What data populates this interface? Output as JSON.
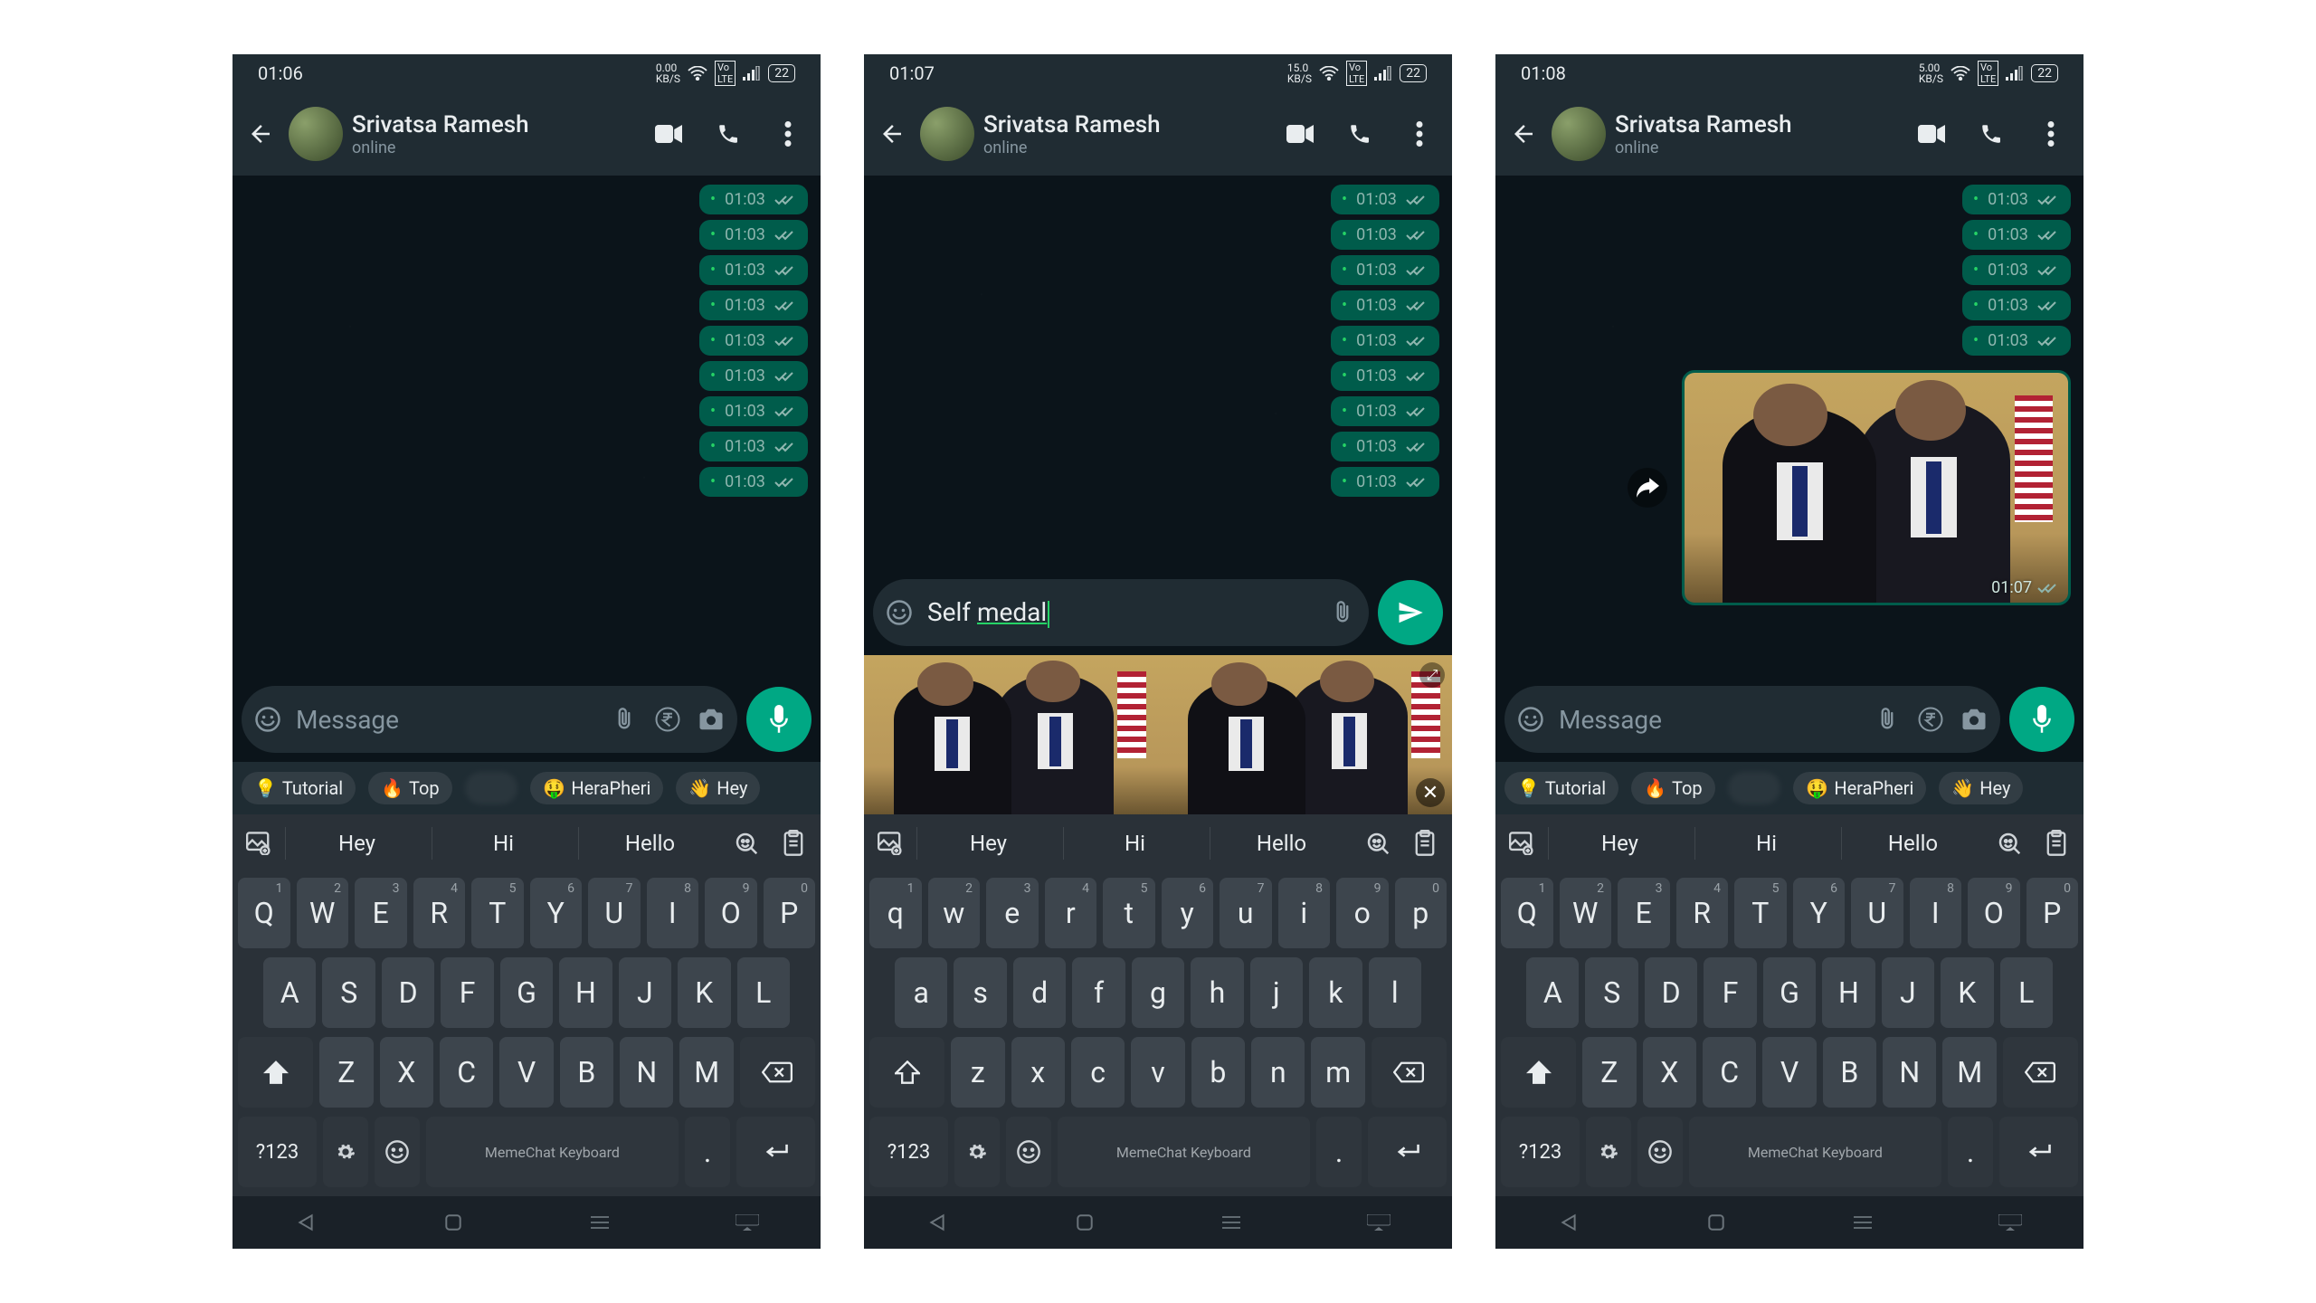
{
  "screens": [
    {
      "statusTime": "01:06",
      "netSpeed": "0.00 KB/S",
      "battery": "22",
      "contactName": "Srivatsa Ramesh",
      "contactStatus": "online",
      "messages": [
        {
          "time": "01:03"
        },
        {
          "time": "01:03"
        },
        {
          "time": "01:03"
        },
        {
          "time": "01:03"
        },
        {
          "time": "01:03"
        },
        {
          "time": "01:03"
        },
        {
          "time": "01:03"
        },
        {
          "time": "01:03"
        },
        {
          "time": "01:03"
        }
      ],
      "inputPlaceholder": "Message",
      "typed": "",
      "fab": "mic",
      "showRupee": true,
      "showCamera": true,
      "showChips": true,
      "showMemeResults": false,
      "showSentImage": false,
      "kbUpper": true
    },
    {
      "statusTime": "01:07",
      "netSpeed": "15.0 KB/S",
      "battery": "22",
      "contactName": "Srivatsa Ramesh",
      "contactStatus": "online",
      "messages": [
        {
          "time": "01:03"
        },
        {
          "time": "01:03"
        },
        {
          "time": "01:03"
        },
        {
          "time": "01:03"
        },
        {
          "time": "01:03"
        },
        {
          "time": "01:03"
        },
        {
          "time": "01:03"
        },
        {
          "time": "01:03"
        },
        {
          "time": "01:03"
        }
      ],
      "inputPlaceholder": "Message",
      "typedPlain": "Self ",
      "typedUnderlined": "medal",
      "fab": "send",
      "showRupee": false,
      "showCamera": false,
      "showChips": false,
      "showMemeResults": true,
      "showSentImage": false,
      "kbUpper": false
    },
    {
      "statusTime": "01:08",
      "netSpeed": "5.00 KB/S",
      "battery": "22",
      "contactName": "Srivatsa Ramesh",
      "contactStatus": "online",
      "messages": [
        {
          "time": "01:03"
        },
        {
          "time": "01:03"
        },
        {
          "time": "01:03"
        },
        {
          "time": "01:03"
        },
        {
          "time": "01:03"
        }
      ],
      "sentImageTime": "01:07",
      "inputPlaceholder": "Message",
      "typed": "",
      "fab": "mic",
      "showRupee": true,
      "showCamera": true,
      "showChips": true,
      "showMemeResults": false,
      "showSentImage": true,
      "kbUpper": true
    }
  ],
  "chips": [
    {
      "emoji": "💡",
      "label": "Tutorial"
    },
    {
      "emoji": "🔥",
      "label": "Top"
    },
    {
      "emoji": "",
      "label": "",
      "blur": true
    },
    {
      "emoji": "🤑",
      "label": "HeraPheri"
    },
    {
      "emoji": "👋",
      "label": "Hey"
    }
  ],
  "suggestions": [
    "Hey",
    "Hi",
    "Hello"
  ],
  "keyboardRows": {
    "upper": [
      [
        [
          "Q",
          "1"
        ],
        [
          "W",
          "2"
        ],
        [
          "E",
          "3"
        ],
        [
          "R",
          "4"
        ],
        [
          "T",
          "5"
        ],
        [
          "Y",
          "6"
        ],
        [
          "U",
          "7"
        ],
        [
          "I",
          "8"
        ],
        [
          "O",
          "9"
        ],
        [
          "P",
          "0"
        ]
      ],
      [
        [
          "A",
          ""
        ],
        [
          "S",
          ""
        ],
        [
          "D",
          ""
        ],
        [
          "F",
          ""
        ],
        [
          "G",
          ""
        ],
        [
          "H",
          ""
        ],
        [
          "J",
          ""
        ],
        [
          "K",
          ""
        ],
        [
          "L",
          ""
        ]
      ],
      [
        [
          "Z",
          ""
        ],
        [
          "X",
          ""
        ],
        [
          "C",
          ""
        ],
        [
          "V",
          ""
        ],
        [
          "B",
          ""
        ],
        [
          "N",
          ""
        ],
        [
          "M",
          ""
        ]
      ]
    ],
    "lower": [
      [
        [
          "q",
          "1"
        ],
        [
          "w",
          "2"
        ],
        [
          "e",
          "3"
        ],
        [
          "r",
          "4"
        ],
        [
          "t",
          "5"
        ],
        [
          "y",
          "6"
        ],
        [
          "u",
          "7"
        ],
        [
          "i",
          "8"
        ],
        [
          "o",
          "9"
        ],
        [
          "p",
          "0"
        ]
      ],
      [
        [
          "a",
          ""
        ],
        [
          "s",
          ""
        ],
        [
          "d",
          ""
        ],
        [
          "f",
          ""
        ],
        [
          "g",
          ""
        ],
        [
          "h",
          ""
        ],
        [
          "j",
          ""
        ],
        [
          "k",
          ""
        ],
        [
          "l",
          ""
        ]
      ],
      [
        [
          "z",
          ""
        ],
        [
          "x",
          ""
        ],
        [
          "c",
          ""
        ],
        [
          "v",
          ""
        ],
        [
          "b",
          ""
        ],
        [
          "n",
          ""
        ],
        [
          "m",
          ""
        ]
      ]
    ]
  },
  "spaceLabel": "MemeChat Keyboard",
  "numKey": "?123"
}
